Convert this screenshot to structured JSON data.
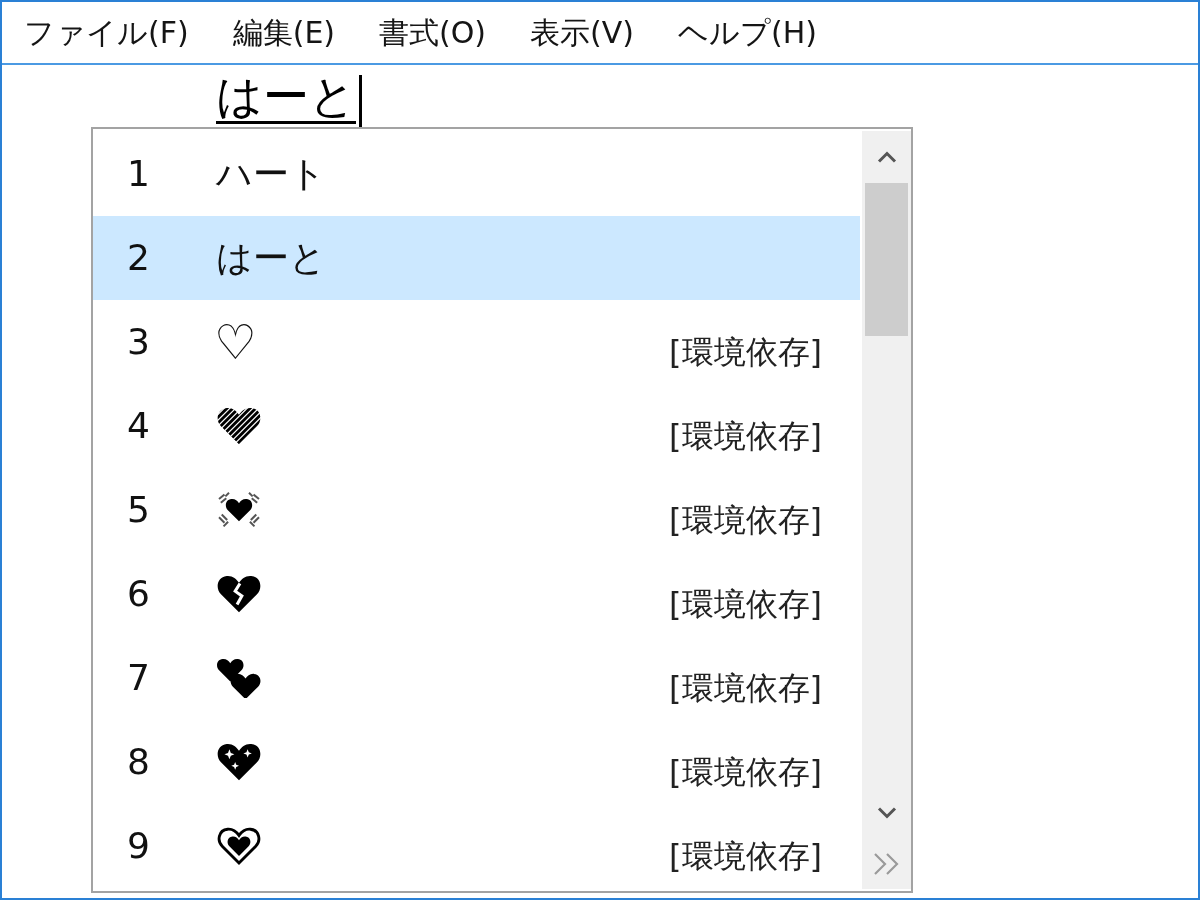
{
  "menu": [
    "ファイル(F)",
    "編集(E)",
    "書式(O)",
    "表示(V)",
    "ヘルプ(H)"
  ],
  "editor": {
    "composition": "はーと"
  },
  "candidate_window": {
    "candidates": [
      {
        "number": "1",
        "kind": "text",
        "text": "ハート",
        "selected": false
      },
      {
        "number": "2",
        "kind": "text",
        "text": "はーと",
        "selected": true
      },
      {
        "number": "3",
        "kind": "symbol",
        "text": "♡",
        "annotation": "[環境依存]",
        "selected": false
      },
      {
        "number": "4",
        "kind": "striped",
        "annotation": "[環境依存]",
        "selected": false
      },
      {
        "number": "5",
        "kind": "vibrating",
        "annotation": "[環境依存]",
        "selected": false
      },
      {
        "number": "6",
        "kind": "broken",
        "annotation": "[環境依存]",
        "selected": false
      },
      {
        "number": "7",
        "kind": "twin",
        "annotation": "[環境依存]",
        "selected": false
      },
      {
        "number": "8",
        "kind": "sparkling",
        "annotation": "[環境依存]",
        "selected": false
      },
      {
        "number": "9",
        "kind": "ringed",
        "annotation": "[環境依存]",
        "selected": false
      }
    ]
  }
}
